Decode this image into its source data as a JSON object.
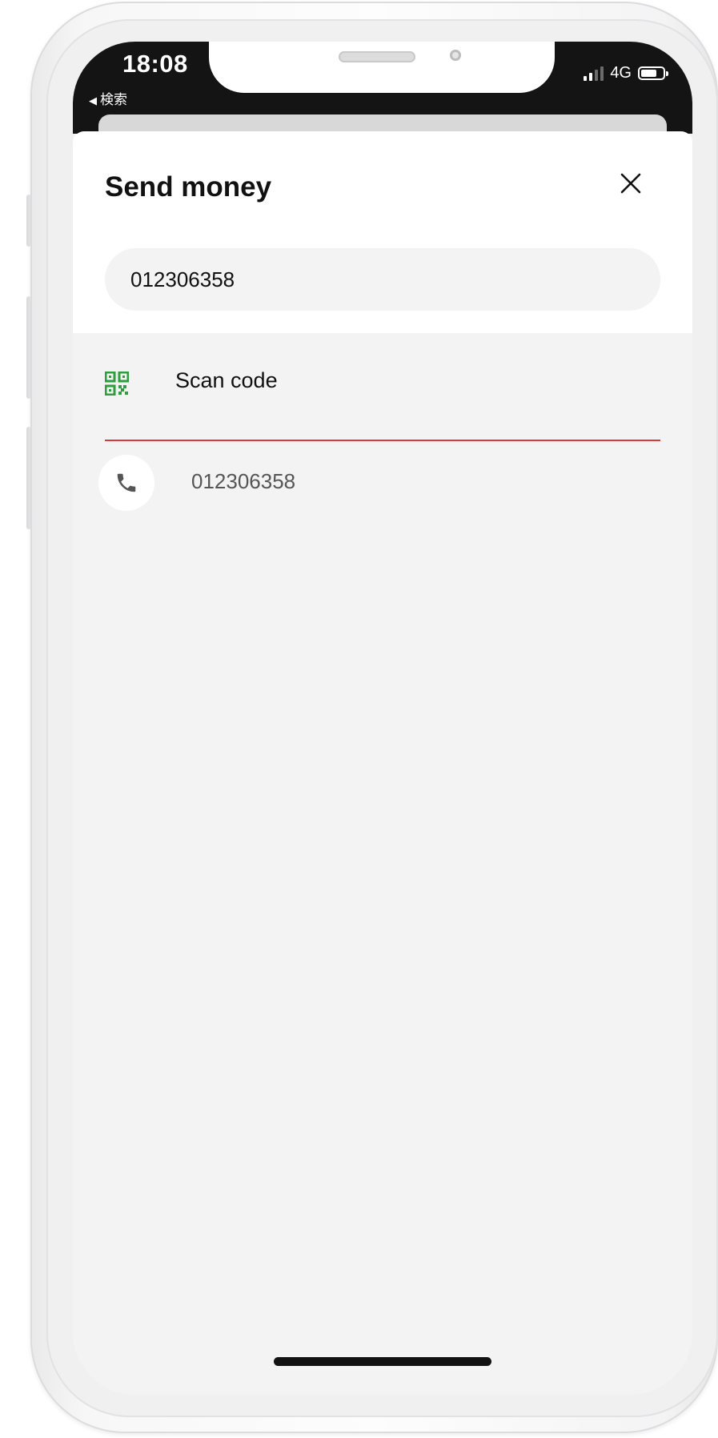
{
  "status_bar": {
    "time": "18:08",
    "back_app": "検索",
    "network": "4G"
  },
  "sheet": {
    "title": "Send money",
    "search": {
      "value": "012306358",
      "placeholder": ""
    }
  },
  "actions": {
    "scan_label": "Scan code"
  },
  "results": [
    {
      "number": "012306358",
      "icon": "phone-icon"
    }
  ],
  "colors": {
    "accent_red": "#d83a3a",
    "qr_green": "#2e9e3e",
    "background": "#f3f3f4"
  }
}
